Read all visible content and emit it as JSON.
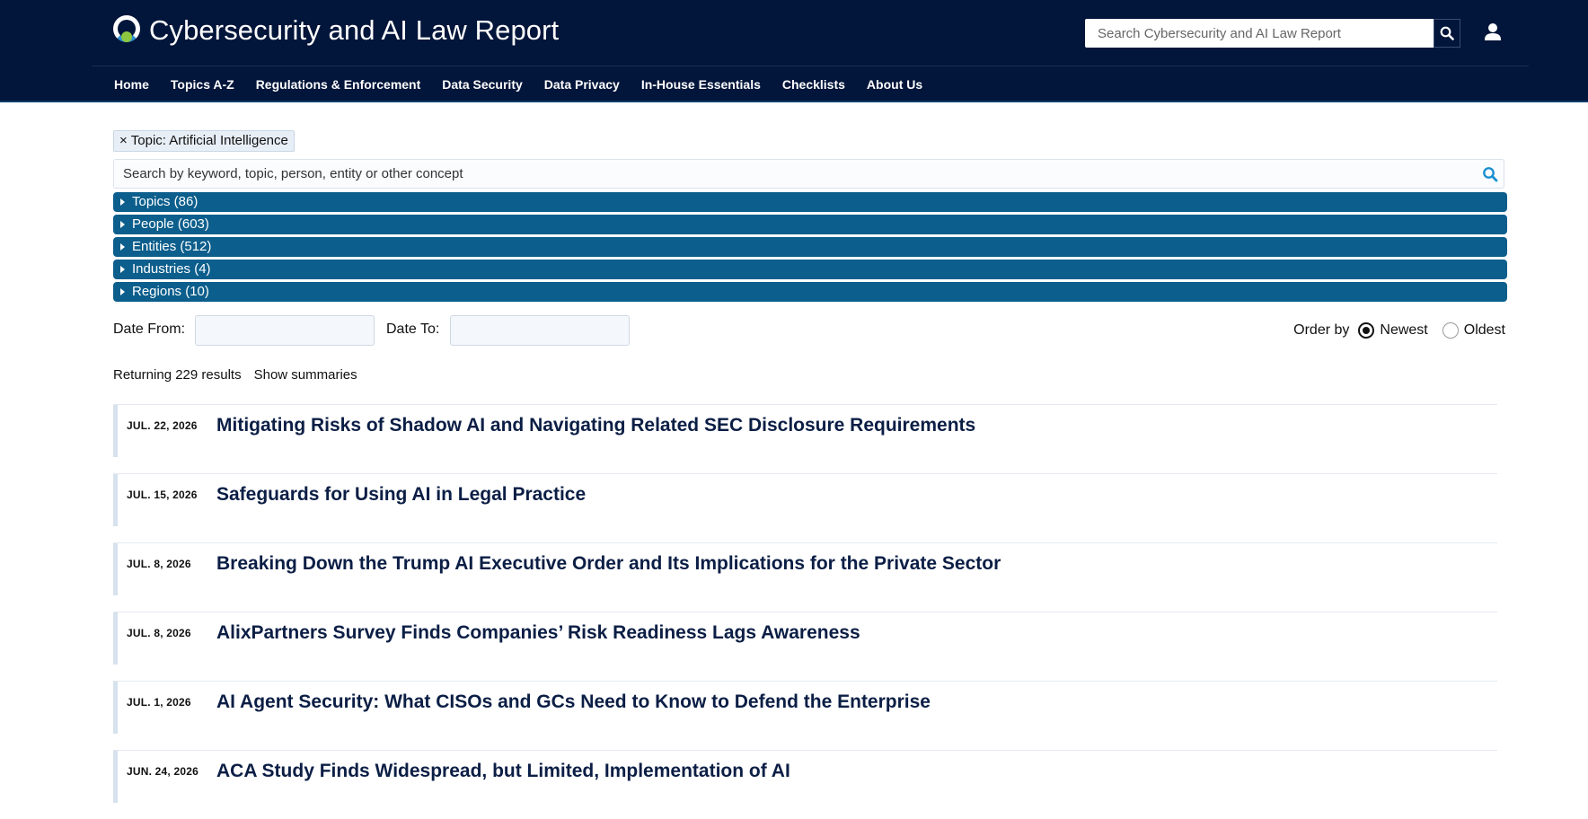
{
  "header": {
    "site_title": "Cybersecurity and AI Law Report",
    "search_placeholder": "Search Cybersecurity and AI Law Report",
    "nav": [
      "Home",
      "Topics A-Z",
      "Regulations & Enforcement",
      "Data Security",
      "Data Privacy",
      "In-House Essentials",
      "Checklists",
      "About Us"
    ]
  },
  "filters": {
    "active_chip_x": "×",
    "active_chip": "Topic: Artificial Intelligence",
    "keyword_placeholder": "Search by keyword, topic, person, entity or other concept",
    "facets": [
      "Topics (86)",
      "People (603)",
      "Entities (512)",
      "Industries (4)",
      "Regions (10)"
    ],
    "date_from_label": "Date From:",
    "date_to_label": "Date To:",
    "order_label": "Order by",
    "order_options": [
      "Newest",
      "Oldest"
    ],
    "order_selected": "Newest"
  },
  "results": {
    "count_text": "Returning 229 results",
    "summaries_link": "Show summaries",
    "items": [
      {
        "date": "JUL. 22, 2026",
        "title": "Mitigating Risks of Shadow AI and Navigating Related SEC Disclosure Requirements"
      },
      {
        "date": "JUL. 15, 2026",
        "title": "Safeguards for Using AI in Legal Practice"
      },
      {
        "date": "JUL. 8, 2026",
        "title": "Breaking Down the Trump AI Executive Order and Its Implications for the Private Sector"
      },
      {
        "date": "JUL. 8, 2026",
        "title": "AlixPartners Survey Finds Companies’ Risk Readiness Lags Awareness"
      },
      {
        "date": "JUL. 1, 2026",
        "title": "AI Agent Security: What CISOs and GCs Need to Know to Defend the Enterprise"
      },
      {
        "date": "JUN. 24, 2026",
        "title": "ACA Study Finds Widespread, but Limited, Implementation of AI"
      }
    ]
  },
  "colors": {
    "header_bg": "#02153a",
    "facet_bg": "#0c5e8c",
    "title_color": "#0b1e45",
    "logo_accent": "#8dc63f",
    "search_icon_blue": "#1a8fd0"
  }
}
